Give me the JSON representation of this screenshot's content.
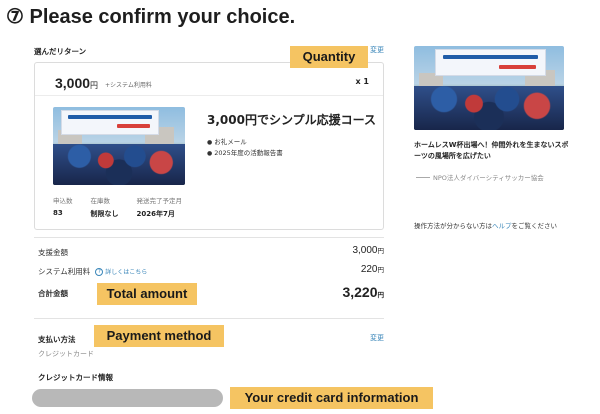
{
  "page": {
    "title": "⑦ Please confirm your choice."
  },
  "reward_section": {
    "label": "選んだリターン",
    "change_label": "変更",
    "price": "3,000",
    "price_unit": "円",
    "fee_note": "+システム利用料",
    "quantity": "x 1",
    "title": "3,000円でシンプル応援コース",
    "items": [
      "お礼メール",
      "2025年度の活動報告書"
    ],
    "stats": [
      {
        "label": "申込数",
        "value": "83"
      },
      {
        "label": "在庫数",
        "value": "制限なし"
      },
      {
        "label": "発送完了予定月",
        "value": "2026年7月"
      }
    ]
  },
  "summary": {
    "support_label": "支援金額",
    "support_value": "3,000",
    "fee_label": "システム利用料",
    "fee_help": "?",
    "fee_detail_link": "詳しくはこちら",
    "fee_value": "220",
    "total_label": "合計金額",
    "total_value": "3,220",
    "unit": "円"
  },
  "payment": {
    "label": "支払い方法",
    "change_label": "変更",
    "method": "クレジットカード",
    "card_info_label": "クレジットカード情報"
  },
  "sidebar": {
    "project_title": "ホームレスW杯出場へ！仲間外れを生まないスポーツの風場所を広げたい",
    "org_name": "NPO法人ダイバーシティサッカー協会",
    "help_text": "操作方法が分からない方は",
    "help_link": "ヘルプ",
    "help_suffix": "をご覧ください"
  },
  "annotations": {
    "quantity": "Quantity",
    "total_amount": "Total amount",
    "payment_method": "Payment method",
    "credit_card": "Your credit card information"
  },
  "colors": {
    "annotation": "#f5c462",
    "link": "#3a86b9"
  }
}
